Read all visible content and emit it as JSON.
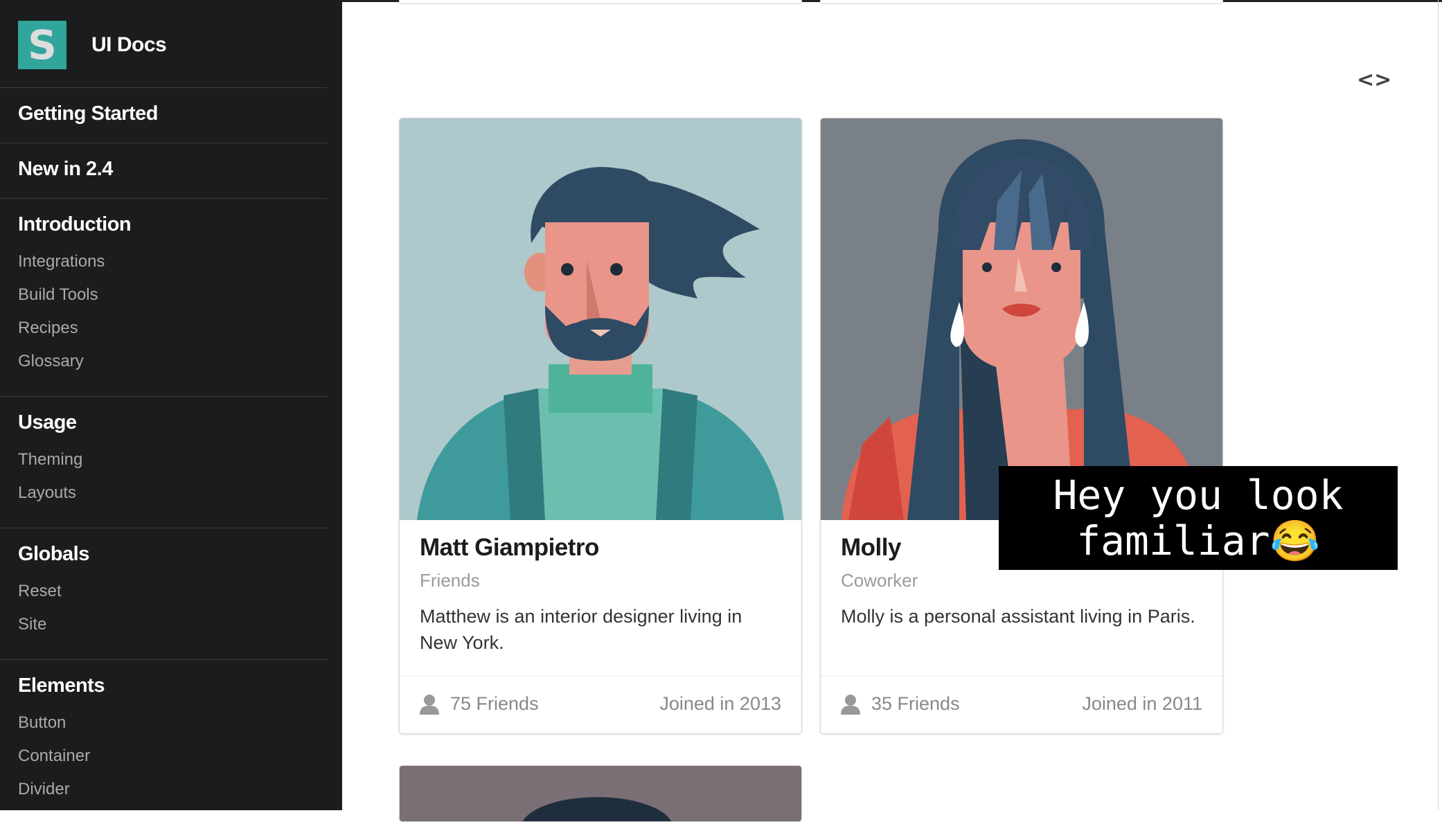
{
  "brand": {
    "logo_letter": "S",
    "name": "UI Docs"
  },
  "sidebar": {
    "getting_started": "Getting Started",
    "new_in": "New in 2.4",
    "introduction": {
      "header": "Introduction",
      "items": [
        "Integrations",
        "Build Tools",
        "Recipes",
        "Glossary"
      ]
    },
    "usage": {
      "header": "Usage",
      "items": [
        "Theming",
        "Layouts"
      ]
    },
    "globals": {
      "header": "Globals",
      "items": [
        "Reset",
        "Site"
      ]
    },
    "elements": {
      "header": "Elements",
      "items": [
        "Button",
        "Container",
        "Divider"
      ]
    }
  },
  "main": {
    "code_toggle_icon": "code-icon"
  },
  "cards": [
    {
      "name": "Matt Giampietro",
      "meta": "Friends",
      "description": "Matthew is an interior designer living in New York.",
      "friends": "75 Friends",
      "joined": "Joined in 2013",
      "image_bg": "#aec9cb"
    },
    {
      "name": "Molly",
      "meta": "Coworker",
      "description": "Molly is a personal assistant living in Paris.",
      "friends": "35 Friends",
      "joined": "Joined in 2011",
      "image_bg": "#7a8088"
    }
  ],
  "caption": {
    "line1": "Hey you look",
    "line2": "familiar😂"
  },
  "colors": {
    "sidebar_bg": "#1b1c1d",
    "brand_accent": "#35bdb2",
    "text_muted": "#888888"
  }
}
